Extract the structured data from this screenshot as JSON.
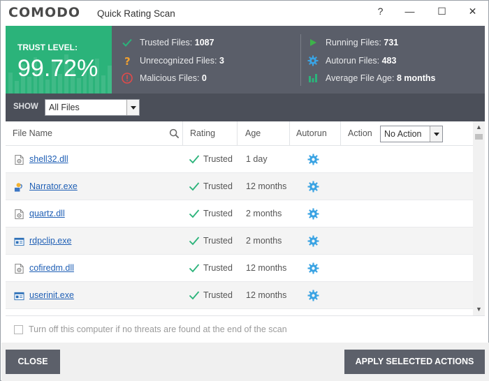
{
  "window": {
    "logo": "COMODO",
    "title": "Quick Rating Scan",
    "help": "?",
    "minimize": "—",
    "maximize": "☐",
    "close": "✕"
  },
  "summary": {
    "trust_label": "TRUST LEVEL:",
    "trust_value": "99.72%",
    "left_stats": [
      {
        "label": "Trusted Files:",
        "value": "1087",
        "icon": "checkmark-icon",
        "color": "#2bb37a"
      },
      {
        "label": "Unrecognized Files:",
        "value": "3",
        "icon": "question-icon",
        "color": "#f0a030"
      },
      {
        "label": "Malicious Files:",
        "value": "0",
        "icon": "alert-circle-icon",
        "color": "#e24a4a"
      }
    ],
    "right_stats": [
      {
        "label": "Running Files:",
        "value": "731",
        "icon": "play-icon",
        "color": "#3db34a"
      },
      {
        "label": "Autorun Files:",
        "value": "483",
        "icon": "gear-icon",
        "color": "#3aa3e3"
      },
      {
        "label": "Average File Age:",
        "value": "8 months",
        "icon": "bar-chart-icon",
        "color": "#2bb37a"
      }
    ]
  },
  "filter": {
    "show_label": "SHOW",
    "show_value": "All Files"
  },
  "table": {
    "headers": {
      "file_name": "File Name",
      "rating": "Rating",
      "age": "Age",
      "autorun": "Autorun",
      "action": "Action",
      "action_value": "No Action"
    },
    "rows": [
      {
        "name": "shell32.dll",
        "rating": "Trusted",
        "age": "1 day",
        "icon": "dll-file-icon"
      },
      {
        "name": "Narrator.exe",
        "rating": "Trusted",
        "age": "12 months",
        "icon": "narrator-app-icon"
      },
      {
        "name": "quartz.dll",
        "rating": "Trusted",
        "age": "2 months",
        "icon": "dll-file-icon"
      },
      {
        "name": "rdpclip.exe",
        "rating": "Trusted",
        "age": "2 months",
        "icon": "exe-window-icon"
      },
      {
        "name": "cofiredm.dll",
        "rating": "Trusted",
        "age": "12 months",
        "icon": "dll-file-icon"
      },
      {
        "name": "userinit.exe",
        "rating": "Trusted",
        "age": "12 months",
        "icon": "exe-window-icon"
      }
    ]
  },
  "shutdown_option": "Turn off this computer if no threats are found at the end of the scan",
  "footer": {
    "close_label": "CLOSE",
    "apply_label": "APPLY SELECTED ACTIONS"
  },
  "colors": {
    "trust_green": "#2bb37a",
    "header_gray": "#5a5e69",
    "filter_gray": "#4b4f59",
    "link_blue": "#1f5fb5",
    "button_gray": "#5c606a"
  }
}
